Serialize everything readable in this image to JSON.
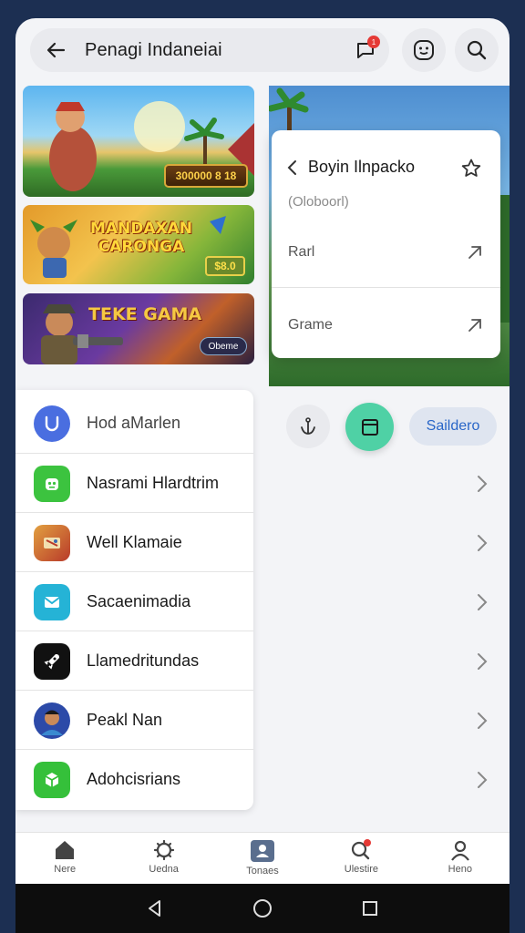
{
  "header": {
    "title": "Penagi Indaneiai",
    "notification_count": "1"
  },
  "banners": [
    {
      "title": "",
      "badge": "300000 8 18"
    },
    {
      "title": "MANDAXAN CARONGA",
      "badge": "$8.0"
    },
    {
      "title": "TEKE GAMA",
      "badge": "Obeme"
    }
  ],
  "popup": {
    "title": "Boyin Ilnpacko",
    "subtitle": "(Oloboorl)",
    "rows": [
      {
        "label": "Rarl"
      },
      {
        "label": "Grame"
      }
    ]
  },
  "actions": {
    "sort_label": "Saildero"
  },
  "list": [
    {
      "label": "Hod aMarlen",
      "icon": "shield-icon",
      "color": "#4a6ee0"
    },
    {
      "label": "Nasrami Hlardtrim",
      "icon": "robot-icon",
      "color": "#3cc33f"
    },
    {
      "label": "Well Klamaie",
      "icon": "game-icon",
      "color": "#c0532b"
    },
    {
      "label": "Sacaenimadia",
      "icon": "envelope-icon",
      "color": "#25b3d6"
    },
    {
      "label": "Llamedritundas",
      "icon": "rocket-icon",
      "color": "#111111"
    },
    {
      "label": "Peakl Nan",
      "icon": "avatar-icon",
      "color": "#2c4aa8"
    },
    {
      "label": "Adohcisrians",
      "icon": "cube-icon",
      "color": "#35c03a"
    }
  ],
  "bottom_nav": [
    {
      "label": "Nere",
      "icon": "home-icon"
    },
    {
      "label": "Uedna",
      "icon": "settings-icon"
    },
    {
      "label": "Tonaes",
      "icon": "profile-card-icon"
    },
    {
      "label": "Ulestire",
      "icon": "search-icon"
    },
    {
      "label": "Heno",
      "icon": "user-icon"
    }
  ]
}
